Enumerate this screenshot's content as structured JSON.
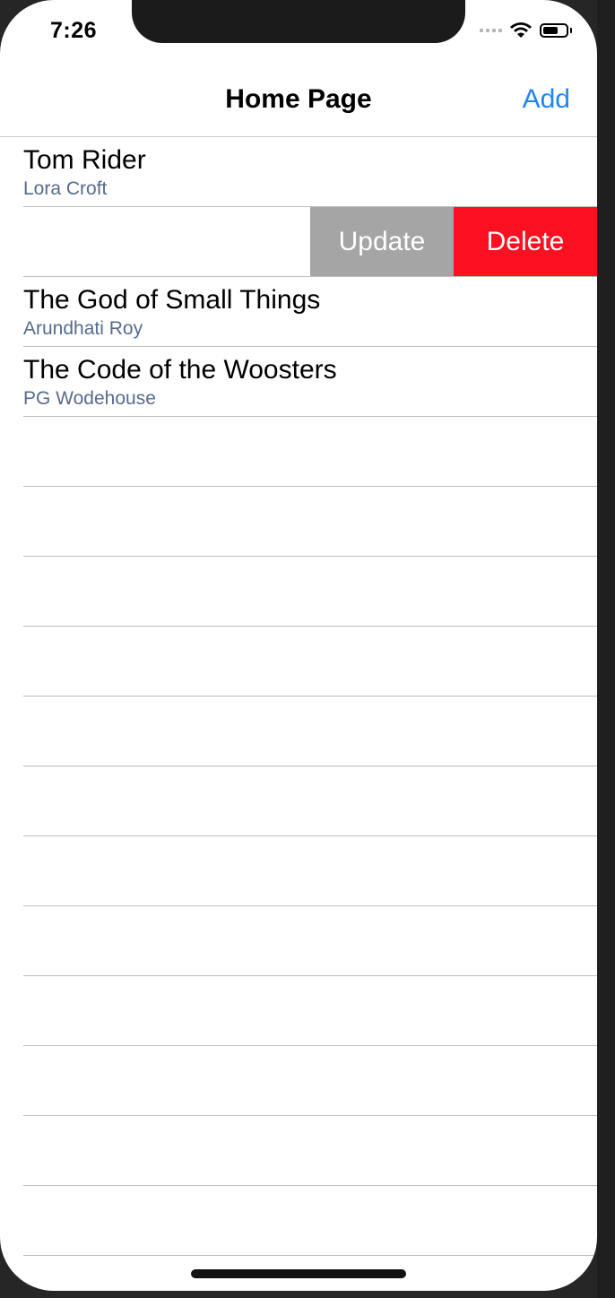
{
  "status_bar": {
    "time": "7:26"
  },
  "nav": {
    "title": "Home Page",
    "add_label": "Add"
  },
  "rows": [
    {
      "title": "Tom Rider",
      "subtitle": "Lora Croft"
    },
    {
      "title": "",
      "subtitle": "",
      "swiped": true
    },
    {
      "title": "The God of Small Things",
      "subtitle": "Arundhati Roy"
    },
    {
      "title": "The Code of the Woosters",
      "subtitle": "PG Wodehouse"
    }
  ],
  "swipe_actions": {
    "update_label": "Update",
    "delete_label": "Delete"
  },
  "colors": {
    "accent": "#1e86f0",
    "subtitle": "#566b8e",
    "update_bg": "#a5a5a5",
    "delete_bg": "#fd1120"
  },
  "icons": [
    "wifi-icon",
    "battery-icon",
    "signal-icon"
  ]
}
